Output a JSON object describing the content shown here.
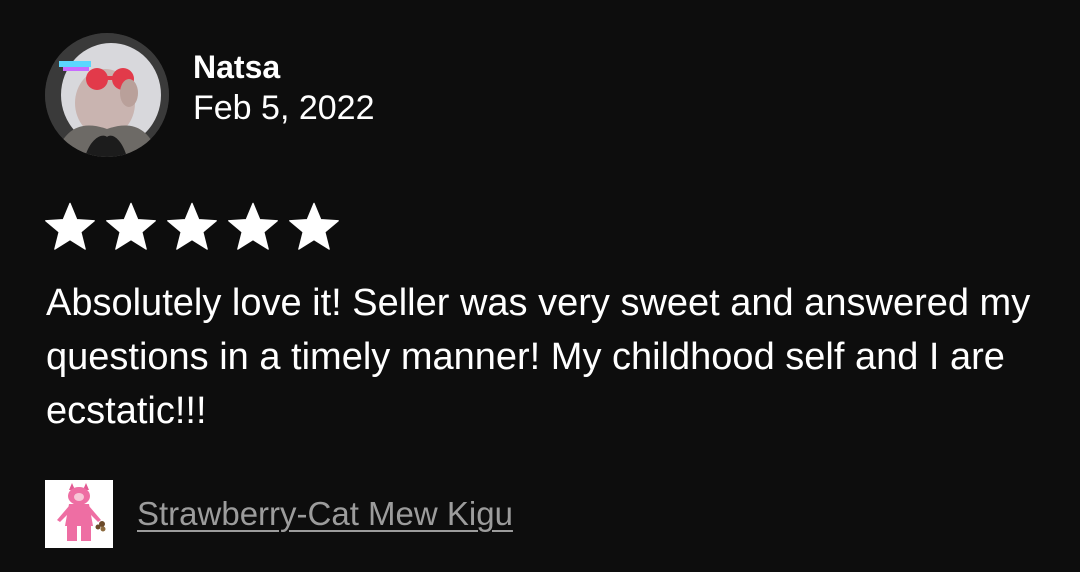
{
  "review": {
    "reviewer_name": "Natsa",
    "date": "Feb 5, 2022",
    "rating": 5,
    "rating_max": 5,
    "text": "Absolutely love it! Seller was very sweet and answered my questions in a timely manner! My childhood self and I are ecstatic!!!",
    "product_name": "Strawberry-Cat Mew Kigu"
  },
  "colors": {
    "background": "#0d0d0d",
    "text": "#ffffff",
    "link": "#9c9c9c",
    "star": "#ffffff"
  },
  "icons": {
    "avatar": "reviewer-avatar-photo",
    "star": "star-icon",
    "product_thumbnail": "pink-cat-kigurumi-thumbnail"
  }
}
